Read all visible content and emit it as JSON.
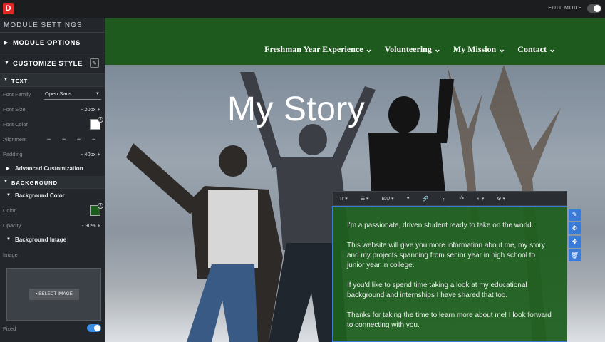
{
  "topbar": {
    "logo": "D",
    "edit_mode": "EDIT MODE"
  },
  "sidebar": {
    "title": "MODULE SETTINGS",
    "close": "×",
    "module_options": "MODULE OPTIONS",
    "customize_style": "CUSTOMIZE STYLE",
    "text_section": "TEXT",
    "font_family_label": "Font Family",
    "font_family_value": "Open Sans",
    "font_size_label": "Font Size",
    "font_size_value": "-   20px +",
    "font_color_label": "Font Color",
    "alignment_label": "Alignment",
    "padding_label": "Padding",
    "padding_value": "-   40px +",
    "advanced": "Advanced Customization",
    "background_section": "BACKGROUND",
    "background_color": "Background Color",
    "color_label": "Color",
    "opacity_label": "Opacity",
    "opacity_value": "-   90% +",
    "background_image": "Background Image",
    "image_label": "Image",
    "select_image": "SELECT IMAGE",
    "fixed_label": "Fixed"
  },
  "nav": {
    "items": [
      "Freshman Year Experience ⌄",
      "Volunteering ⌄",
      "My Mission ⌄",
      "Contact ⌄"
    ]
  },
  "hero": {
    "title": "My Story"
  },
  "toolbar": {
    "items": [
      "Tr ▾",
      "☰ ▾",
      "B/U ▾",
      "❝",
      "🔗",
      "⋮",
      "√x",
      "◐ ▾",
      "⚙ ▾"
    ]
  },
  "content": {
    "p1": "I'm a passionate, driven student ready to take on the world.",
    "p2": "This website will give you more information about me, my story and my projects spanning from senior year in high school to junior year in college.",
    "p3": "If you'd like to spend time taking a look at my educational background and internships I have shared that too.",
    "p4": "Thanks for taking the time to learn more about me! I look forward to connecting with you."
  },
  "colors": {
    "brand_green": "#1e5a1e",
    "accent_blue": "#3b7bd8"
  }
}
